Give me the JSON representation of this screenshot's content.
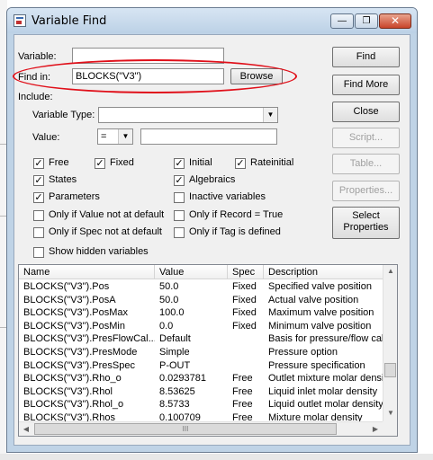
{
  "window": {
    "title": "Variable Find",
    "minimize_label": "—",
    "restore_label": "❐",
    "close_label": "✕"
  },
  "form": {
    "variable_label": "Variable:",
    "variable_value": "",
    "find_in_label": "Find in:",
    "find_in_value": "BLOCKS(\"V3\")",
    "browse_label": "Browse",
    "include_label": "Include:",
    "variable_type_label": "Variable Type:",
    "variable_type_value": "",
    "value_label": "Value:",
    "value_operator": "=",
    "value_value": ""
  },
  "checkboxes": [
    {
      "label": "Free",
      "checked": true
    },
    {
      "label": "Fixed",
      "checked": true
    },
    {
      "label": "Initial",
      "checked": true
    },
    {
      "label": "Rateinitial",
      "checked": true
    },
    {
      "label": "States",
      "checked": true
    },
    {
      "label": "Algebraics",
      "checked": true
    },
    {
      "label": "Parameters",
      "checked": true
    },
    {
      "label": "Inactive variables",
      "checked": false
    },
    {
      "label": "Only if Value not at default",
      "checked": false
    },
    {
      "label": "Only if Record = True",
      "checked": false
    },
    {
      "label": "Only if Spec not at default",
      "checked": false
    },
    {
      "label": "Only if Tag is defined",
      "checked": false
    },
    {
      "label": "Show hidden variables",
      "checked": false
    }
  ],
  "buttons": {
    "find": "Find",
    "find_more": "Find More",
    "close": "Close",
    "script": "Script...",
    "table": "Table...",
    "properties": "Properties...",
    "select_properties_line1": "Select",
    "select_properties_line2": "Properties"
  },
  "table": {
    "headers": [
      "Name",
      "Value",
      "Spec",
      "Description"
    ],
    "rows": [
      [
        "BLOCKS(\"V3\").Pos",
        "50.0",
        "Fixed",
        "Specified valve position"
      ],
      [
        "BLOCKS(\"V3\").PosA",
        "50.0",
        "Fixed",
        "Actual valve position"
      ],
      [
        "BLOCKS(\"V3\").PosMax",
        "100.0",
        "Fixed",
        "Maximum valve position"
      ],
      [
        "BLOCKS(\"V3\").PosMin",
        "0.0",
        "Fixed",
        "Minimum valve position"
      ],
      [
        "BLOCKS(\"V3\").PresFlowCal...",
        "Default",
        "",
        "Basis for pressure/flow cal..."
      ],
      [
        "BLOCKS(\"V3\").PresMode",
        "Simple",
        "",
        "Pressure option"
      ],
      [
        "BLOCKS(\"V3\").PresSpec",
        "P-OUT",
        "",
        "Pressure specification"
      ],
      [
        "BLOCKS(\"V3\").Rho_o",
        "0.0293781",
        "Free",
        "Outlet mixture molar density"
      ],
      [
        "BLOCKS(\"V3\").Rhol",
        "8.53625",
        "Free",
        "Liquid inlet molar density"
      ],
      [
        "BLOCKS(\"V3\").Rhol_o",
        "8.5733",
        "Free",
        "Liquid outlet molar density"
      ],
      [
        "BLOCKS(\"V3\").Rhos",
        "0.100709",
        "Free",
        "Mixture molar density"
      ]
    ],
    "scroll_up": "▲",
    "scroll_down": "▼",
    "scroll_left": "◀",
    "scroll_right": "▶",
    "thumb_grip": "III"
  }
}
